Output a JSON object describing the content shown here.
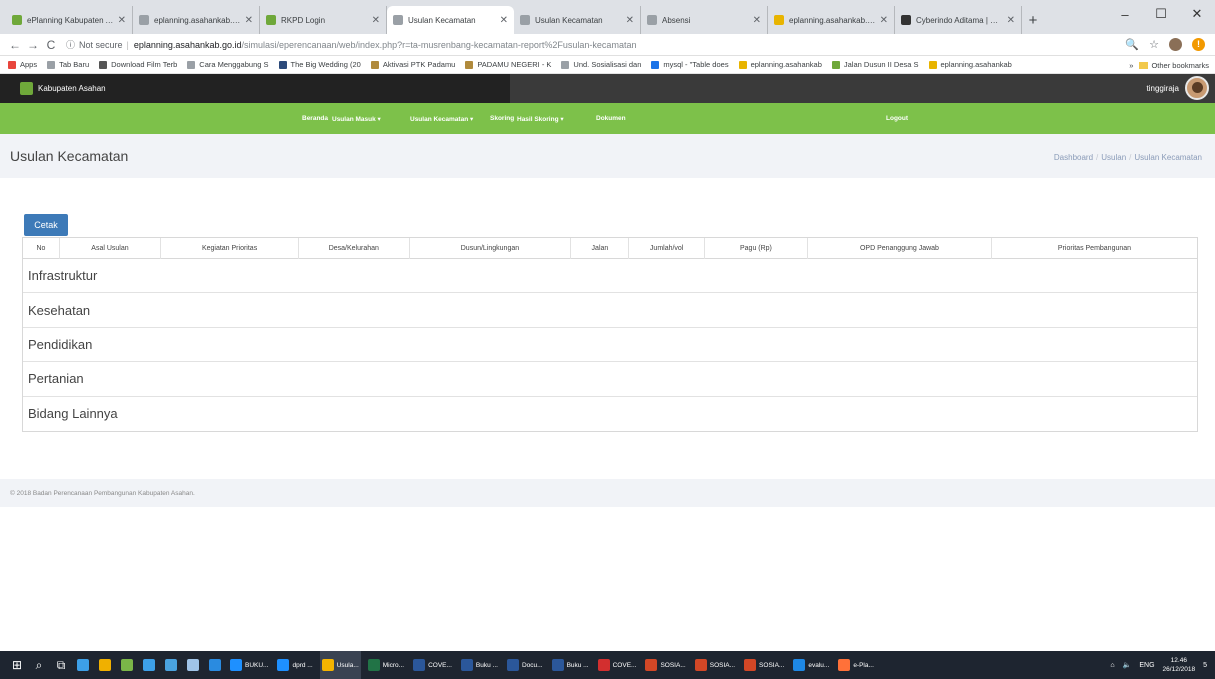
{
  "browser": {
    "tabs": [
      {
        "title": "ePlanning Kabupaten Asaha",
        "color": "#6fa83a"
      },
      {
        "title": "eplanning.asahankab.go.id",
        "color": "#9aa0a6"
      },
      {
        "title": "RKPD Login",
        "color": "#6fa83a"
      },
      {
        "title": "Usulan Kecamatan",
        "color": "#9aa0a6"
      },
      {
        "title": "Usulan Kecamatan",
        "color": "#9aa0a6"
      },
      {
        "title": "Absensi",
        "color": "#9aa0a6"
      },
      {
        "title": "eplanning.asahankab.go.id",
        "color": "#e8b400"
      },
      {
        "title": "Cyberindo Aditama | Speed",
        "color": "#333333"
      }
    ],
    "active_tab_index": 3,
    "new_tab": "+",
    "window_controls": {
      "minimize": "–",
      "maximize": "☐",
      "close": "✕"
    },
    "nav": {
      "back": "←",
      "forward": "→",
      "reload": "C"
    },
    "url": {
      "security": "Not secure",
      "host": "eplanning.asahankab.go.id",
      "path": "/simulasi/eperencanaan/web/index.php?r=ta-musrenbang-kecamatan-report%2Fusulan-kecamatan"
    },
    "omni_icons": {
      "zoom": "🔍",
      "star": "☆",
      "warn": "!"
    },
    "bookmarks": [
      {
        "label": "Apps",
        "color": "#e8453c"
      },
      {
        "label": "Tab Baru",
        "color": "#9aa0a6"
      },
      {
        "label": "Download Film Terb",
        "color": "#555555"
      },
      {
        "label": "Cara Menggabung S",
        "color": "#9aa0a6"
      },
      {
        "label": "The Big Wedding (20",
        "color": "#2c4a7a"
      },
      {
        "label": "Aktivasi PTK Padamu",
        "color": "#b08a3c"
      },
      {
        "label": "PADAMU NEGERI - K",
        "color": "#b08a3c"
      },
      {
        "label": "Und. Sosialisasi dan",
        "color": "#9aa0a6"
      },
      {
        "label": "mysql - \"Table does",
        "color": "#1a73e8"
      },
      {
        "label": "eplanning.asahankab",
        "color": "#e8b400"
      },
      {
        "label": "Jalan Dusun II Desa S",
        "color": "#6fa83a"
      },
      {
        "label": "eplanning.asahankab",
        "color": "#e8b400"
      }
    ],
    "bookmarks_more": "»",
    "other_bookmarks": "Other bookmarks"
  },
  "app": {
    "brand": "Kabupaten Asahan",
    "user": "tinggiraja",
    "nav": [
      {
        "label": "Beranda"
      },
      {
        "label": "Usulan Masuk ▾"
      },
      {
        "label": "Usulan Kecamatan ▾"
      },
      {
        "label": "Skoring"
      },
      {
        "label": "Hasil Skoring ▾"
      },
      {
        "label": "Dokumen"
      }
    ],
    "logout": "Logout"
  },
  "page": {
    "title": "Usulan Kecamatan",
    "breadcrumb": [
      "Dashboard",
      "Usulan",
      "Usulan Kecamatan"
    ],
    "print_button": "Cetak",
    "table": {
      "columns": [
        "No",
        "Asal Usulan",
        "Kegiatan Prioritas",
        "Desa/Kelurahan",
        "Dusun/Lingkungan",
        "Jalan",
        "Jumlah/vol",
        "Pagu (Rp)",
        "OPD Penanggung Jawab",
        "Prioritas Pembangunan"
      ],
      "groups": [
        "Infrastruktur",
        "Kesehatan",
        "Pendidikan",
        "Pertanian",
        "Bidang Lainnya"
      ]
    },
    "footer": "© 2018 Badan Perencanaan Pembangunan Kabupaten Asahan."
  },
  "taskbar": {
    "system_icons": [
      "⊞",
      "⌕",
      "⧉"
    ],
    "apps": [
      {
        "label": "BUKU...",
        "color": "#1e90ff"
      },
      {
        "label": "dprd ...",
        "color": "#1e90ff"
      },
      {
        "label": "Usula...",
        "color": "#f4b400",
        "active": true
      },
      {
        "label": "Micro...",
        "color": "#217346"
      },
      {
        "label": "COVE...",
        "color": "#2b579a"
      },
      {
        "label": "Buku ...",
        "color": "#2b579a"
      },
      {
        "label": "Docu...",
        "color": "#2b579a"
      },
      {
        "label": "Buku ...",
        "color": "#2b579a"
      },
      {
        "label": "COVE...",
        "color": "#d32f2f"
      },
      {
        "label": "SOSIA...",
        "color": "#d24726"
      },
      {
        "label": "SOSIA...",
        "color": "#d24726"
      },
      {
        "label": "SOSIA...",
        "color": "#d24726"
      },
      {
        "label": "evalu...",
        "color": "#1e88e5"
      },
      {
        "label": "e-Pla...",
        "color": "#ff7139"
      }
    ],
    "tray": {
      "lang": "ENG",
      "time": "12.46",
      "date": "26/12/2018",
      "notification": "5"
    }
  }
}
